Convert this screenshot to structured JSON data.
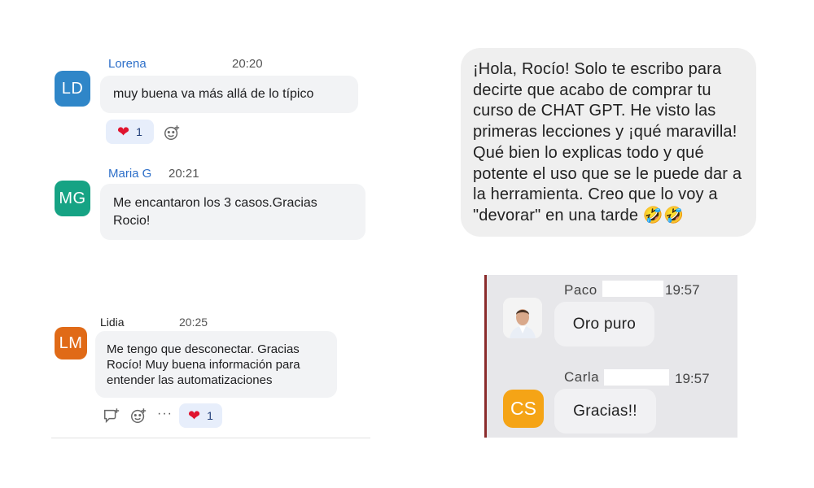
{
  "left_chat": {
    "messages": [
      {
        "initials": "LD",
        "avatar_color": "#2f86c8",
        "name": "Lorena",
        "name_color": "#2d6fc9",
        "time": "20:20",
        "text": "muy buena va más allá de lo típico",
        "reaction_count": "1"
      },
      {
        "initials": "MG",
        "avatar_color": "#16a384",
        "name": "Maria G",
        "name_color": "#2d6fc9",
        "time": "20:21",
        "text": "Me encantaron los 3 casos.Gracias Rocio!"
      },
      {
        "initials": "LM",
        "avatar_color": "#e06a17",
        "name": "Lidia",
        "name_color": "#222222",
        "time": "20:25",
        "text": "Me tengo que desconectar. Gracias Rocío! Muy buena información para entender las automatizaciones",
        "reaction_count": "1"
      }
    ],
    "more_label": "···"
  },
  "right_top": {
    "text": "¡Hola, Rocío! Solo te escribo para decirte que acabo de comprar tu curso de CHAT GPT. He visto las primeras lecciones y ¡qué maravilla! Qué bien lo explicas todo y qué potente el uso que se le puede dar a la herramienta. Creo que lo voy a \"devorar\" en una tarde 🤣🤣"
  },
  "right_bottom": {
    "messages": [
      {
        "name": "Paco",
        "time": "19:57",
        "text": "Oro puro",
        "avatar": "man-photo-avatar"
      },
      {
        "name": "Carla",
        "time": "19:57",
        "text": "Gracias!!",
        "initials": "CS",
        "avatar_color": "#f5a416"
      }
    ]
  },
  "icons": [
    "heart-icon",
    "add-reaction-icon",
    "reply-thread-icon",
    "more-options-icon"
  ]
}
